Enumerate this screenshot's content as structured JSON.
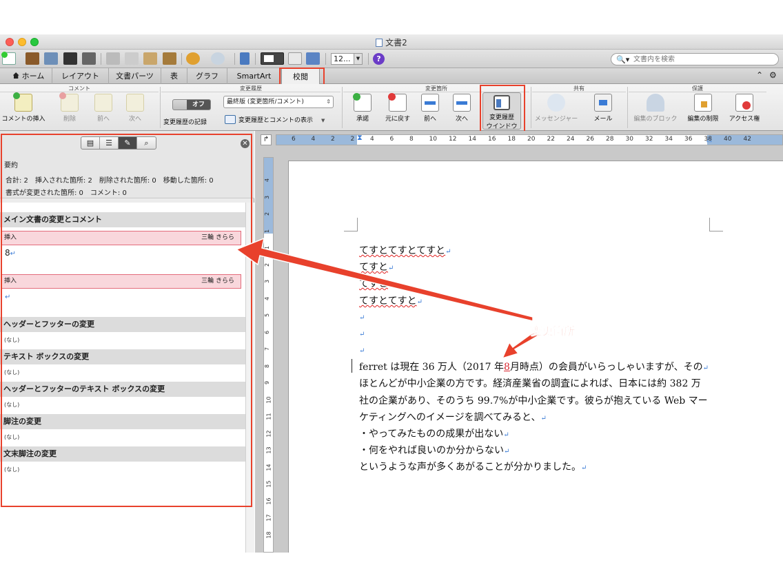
{
  "window": {
    "title": "文書2"
  },
  "toolbar": {
    "zoom": "12...",
    "search_placeholder": "文書内を検索",
    "help": "?"
  },
  "tabs": [
    {
      "label": "ホーム"
    },
    {
      "label": "レイアウト"
    },
    {
      "label": "文書パーツ"
    },
    {
      "label": "表"
    },
    {
      "label": "グラフ"
    },
    {
      "label": "SmartArt"
    },
    {
      "label": "校閲"
    }
  ],
  "ribbon": {
    "groups": {
      "comment": "コメント",
      "tracking": "変更履歴",
      "changes": "変更箇所",
      "share": "共有",
      "protect": "保護"
    },
    "buttons": {
      "insert_comment": "コメントの挿入",
      "delete": "削除",
      "prev_comment": "前へ",
      "next_comment": "次へ",
      "toggle_state": "オフ",
      "track_changes": "変更履歴の記録",
      "view_option": "最終版 (変更箇所/コメント)",
      "show_markup": "変更履歴とコメントの表示",
      "accept": "承諾",
      "reject": "元に戻す",
      "prev_change": "前へ",
      "next_change": "次へ",
      "review_pane_1": "変更履歴",
      "review_pane_2": "ウインドウ",
      "messenger": "メッセンジャー",
      "mail": "メール",
      "block_authors": "編集のブロック",
      "restrict_editing": "編集の制限",
      "permissions": "アクセス権"
    }
  },
  "pane": {
    "summary_title": "要約",
    "summary_line1": "合計: 2　挿入された箇所: 2　削除された箇所: 0　移動した箇所: 0",
    "summary_line2": "書式が変更された箇所: 0　コメント: 0",
    "main_heading": "メイン文書の変更とコメント",
    "revisions": [
      {
        "type": "挿入",
        "author": "三輪 きらら",
        "text": "8"
      },
      {
        "type": "挿入",
        "author": "三輪 きらら",
        "text": ""
      }
    ],
    "sections": [
      {
        "title": "ヘッダーとフッターの変更",
        "value": "(なし)"
      },
      {
        "title": "テキスト ボックスの変更",
        "value": "(なし)"
      },
      {
        "title": "ヘッダーとフッターのテキスト ボックスの変更",
        "value": "(なし)"
      },
      {
        "title": "脚注の変更",
        "value": "(なし)"
      },
      {
        "title": "文末脚注の変更",
        "value": "(なし)"
      }
    ]
  },
  "ruler": {
    "h": [
      "6",
      "4",
      "2",
      "2",
      "4",
      "6",
      "8",
      "10",
      "12",
      "14",
      "16",
      "18",
      "20",
      "22",
      "24",
      "26",
      "28",
      "30",
      "32",
      "34",
      "36",
      "38",
      "40",
      "42"
    ],
    "v": [
      "4",
      "3",
      "2",
      "1",
      "1",
      "2",
      "3",
      "4",
      "5",
      "6",
      "7",
      "8",
      "9",
      "10",
      "11",
      "12",
      "13",
      "14",
      "15",
      "16",
      "17",
      "18"
    ]
  },
  "document": {
    "lines": [
      "てすとてすとてすと",
      "てすと",
      "てすと",
      "てすとてすと"
    ],
    "para1_a": "ferret は現在 36 万人（2017 年",
    "para1_ins": "8",
    "para1_b": "月時点）の会員がいらっしゃいますが、その",
    "para2": "ほとんどが中小企業の方です。経済産業省の調査によれば、日本には約 382 万",
    "para3": "社の企業があり、そのうち 99.7%が中小企業です。彼らが抱えている Web マー",
    "para4": "ケティングへのイメージを調べてみると、",
    "bullet1": "・やってみたものの成果が出ない",
    "bullet2": "・何をやれば良いのか分からない",
    "para5": "というような声が多くあがることが分かりました。",
    "para_mark": "↵"
  },
  "annotation": {
    "label": "変更箇所",
    "color": "#e8412c"
  }
}
